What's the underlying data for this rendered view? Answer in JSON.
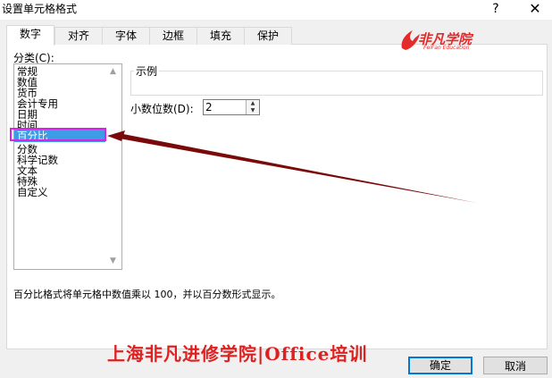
{
  "title": "设置单元格格式",
  "titlebar": {
    "help_label": "?",
    "close_label": "✕"
  },
  "tabs": [
    {
      "label": "数字"
    },
    {
      "label": "对齐"
    },
    {
      "label": "字体"
    },
    {
      "label": "边框"
    },
    {
      "label": "填充"
    },
    {
      "label": "保护"
    }
  ],
  "logo": {
    "text": "非凡学院",
    "sub": "FeiFan Education"
  },
  "category": {
    "label": "分类(C):",
    "items": [
      "常规",
      "数值",
      "货币",
      "会计专用",
      "日期",
      "时间",
      "百分比",
      "分数",
      "科学记数",
      "文本",
      "特殊",
      "自定义"
    ],
    "selected": "百分比"
  },
  "sample": {
    "label": "示例"
  },
  "decimal": {
    "label": "小数位数(D):",
    "value": "2"
  },
  "description": "百分比格式将单元格中数值乘以 100，并以百分数形式显示。",
  "watermark": "上海非凡进修学院|Office培训",
  "buttons": {
    "ok": "确定",
    "cancel": "取消"
  },
  "colors": {
    "accent": "#0078d7",
    "selection": "#3c9ce5",
    "highlight": "#e020e0",
    "arrow": "#7a0a0a",
    "watermark": "#e02020"
  }
}
